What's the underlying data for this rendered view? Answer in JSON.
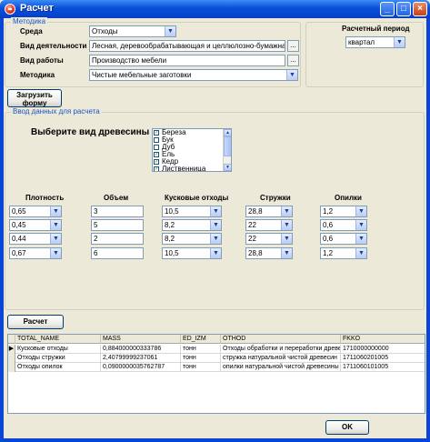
{
  "window": {
    "title": "Расчет"
  },
  "title_buttons": {
    "minimize": "_",
    "maximize": "□",
    "close": "×"
  },
  "methodology": {
    "legend": "Методика",
    "sreda_label": "Среда",
    "sreda_value": "Отходы",
    "activity_label": "Вид деятельности",
    "activity_value": "Лесная, деревообрабатывающая и целлюлозно-бумажная пром",
    "work_label": "Вид работы",
    "work_value": "Производство мебели",
    "method_label": "Методика",
    "method_value": "Чистые мебельные заготовки",
    "dots": "..."
  },
  "period": {
    "label": "Расчетный период",
    "value": "квартал"
  },
  "load_button": "Загрузить\nформу",
  "input": {
    "legend": "Ввод данных для расчета",
    "wood_label": "Выберите вид древесины",
    "wood_list": [
      {
        "name": "Береза",
        "checked": true
      },
      {
        "name": "Бук",
        "checked": false
      },
      {
        "name": "Дуб",
        "checked": false
      },
      {
        "name": "Ель",
        "checked": true
      },
      {
        "name": "Кедр",
        "checked": true
      },
      {
        "name": "Лиственница",
        "checked": true
      }
    ],
    "columns": {
      "density": "Плотность",
      "volume": "Объем",
      "pieces": "Кусковые отходы",
      "shavings": "Стружки",
      "sawdust": "Опилки"
    },
    "rows": [
      {
        "density": "0,65",
        "volume": "3",
        "pieces": "10,5",
        "shavings": "28,8",
        "sawdust": "1,2"
      },
      {
        "density": "0,45",
        "volume": "5",
        "pieces": "8,2",
        "shavings": "22",
        "sawdust": "0,6"
      },
      {
        "density": "0,44",
        "volume": "2",
        "pieces": "8,2",
        "shavings": "22",
        "sawdust": "0,6"
      },
      {
        "density": "0,67",
        "volume": "6",
        "pieces": "10,5",
        "shavings": "28,8",
        "sawdust": "1,2"
      }
    ]
  },
  "calc_button": "Расчет",
  "grid": {
    "headers": [
      "TOTAL_NAME",
      "MASS",
      "ED_IZM",
      "OTHOD",
      "FKKO"
    ],
    "rows": [
      {
        "total_name": "Кусковые отходы",
        "mass": "0,884000000333786",
        "ed_izm": "тонн",
        "othod": "Отходы обработки и переработки древе",
        "fkko": "1710000000000"
      },
      {
        "total_name": "Отходы стружки",
        "mass": "2,40799999237061",
        "ed_izm": "тонн",
        "othod": "стружка натуральной чистой древесин",
        "fkko": "1711060201005"
      },
      {
        "total_name": "Отходы опилок",
        "mass": "0,0900000035762787",
        "ed_izm": "тонн",
        "othod": "опилки натуральной чистой древесины",
        "fkko": "1711060101005"
      }
    ],
    "current_row_marker": "▶"
  },
  "ok_button": "OK",
  "icons": {
    "dropdown": "chevron-down-icon",
    "close": "close-icon",
    "app": "app-icon"
  }
}
